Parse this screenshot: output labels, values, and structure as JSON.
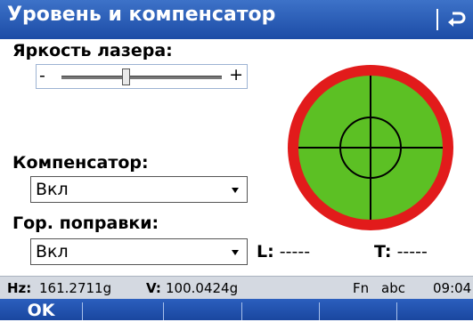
{
  "window": {
    "title": "Уровень и компенсатор"
  },
  "laser": {
    "label": "Яркость лазера:",
    "minus": "-",
    "plus": "+",
    "level": 0.4
  },
  "compensator": {
    "label": "Компенсатор:",
    "value": "Вкл"
  },
  "horizontal_corrections": {
    "label": "Гор. поправки:",
    "value": "Вкл"
  },
  "tilt": {
    "l_label": "L:",
    "l_value": "-----",
    "t_label": "T:",
    "t_value": "-----"
  },
  "status": {
    "hz_label": "Hz:",
    "hz_value": "161.2711g",
    "v_label": "V:",
    "v_value": "100.0424g",
    "fn": "Fn",
    "input_mode": "abc",
    "time": "09:04"
  },
  "softkeys": {
    "ok": "OK"
  },
  "colors": {
    "titlebar": "#1c4ca6",
    "bubble_ring": "#e21b1b",
    "bubble_fill": "#5cc024",
    "statusbar": "#d4d9e1"
  },
  "icons": {
    "back": "back-arrow-icon",
    "dropdown": "triangle-down-icon"
  }
}
